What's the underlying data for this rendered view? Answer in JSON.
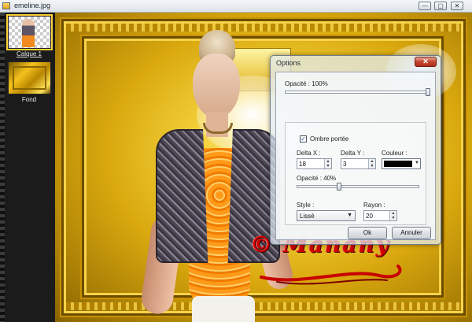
{
  "window": {
    "title": "emeline.jpg",
    "controls": {
      "minimize": "—",
      "restore": "▢",
      "close": "✕"
    }
  },
  "layers": [
    {
      "name": "Calque 1",
      "selected": true,
      "thumb": "checker-figure"
    },
    {
      "name": "Fond",
      "selected": false,
      "thumb": "gold-frame"
    }
  ],
  "watermark": {
    "text": "© Manany"
  },
  "dialog": {
    "title": "Options",
    "close_label": "✕",
    "opacity": {
      "label": "Opacité : 100%",
      "value": 100
    },
    "shadow": {
      "checkbox_label": "Ombre portée",
      "checked": true,
      "delta_x": {
        "label": "Delta X :",
        "value": "18"
      },
      "delta_y": {
        "label": "Delta Y :",
        "value": "3"
      },
      "color": {
        "label": "Couleur :",
        "value": "#000000"
      },
      "opacity": {
        "label": "Opacité : 40%",
        "value": 40
      },
      "style": {
        "label": "Style :",
        "value": "Lissé"
      },
      "radius": {
        "label": "Rayon :",
        "value": "20"
      }
    },
    "ok_label": "Ok",
    "cancel_label": "Annuler"
  }
}
